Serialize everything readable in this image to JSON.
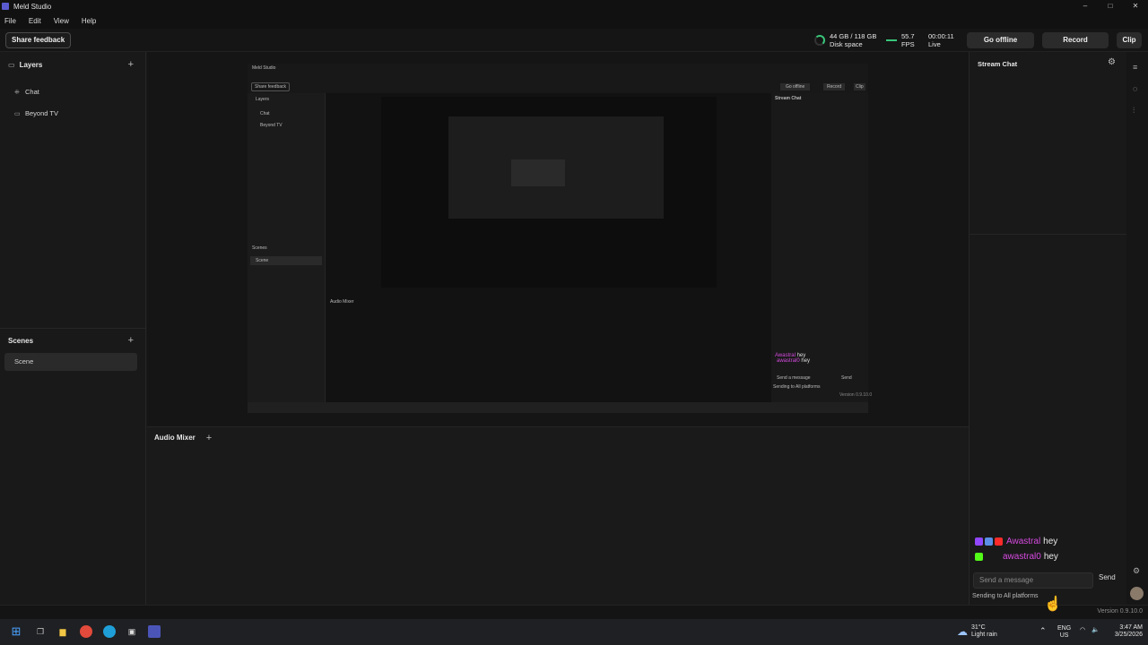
{
  "window": {
    "title": "Meld Studio",
    "controls": [
      "–",
      "□",
      "✕"
    ]
  },
  "menu": [
    "File",
    "Edit",
    "View",
    "Help"
  ],
  "toolbar": {
    "share_feedback": "Share feedback",
    "disk_value": "44 GB / 118 GB",
    "disk_label": "Disk space",
    "fps_value": "55.7",
    "fps_label": "FPS",
    "timer_value": "00:00:11",
    "timer_label": "Live",
    "go_offline": "Go offline",
    "record": "Record",
    "clip": "Clip"
  },
  "layers": {
    "title": "Layers",
    "items": [
      {
        "label": "Chat",
        "icon": "chat-layer-icon"
      },
      {
        "label": "Beyond TV",
        "icon": "monitor-icon"
      }
    ]
  },
  "scenes": {
    "title": "Scenes",
    "items": [
      "Scene"
    ]
  },
  "audio_mixer": {
    "title": "Audio Mixer"
  },
  "preview": {
    "title": "Meld Studio",
    "share_feedback": "Share feedback",
    "layers": "Layers",
    "chat": "Chat",
    "beyond_tv": "Beyond TV",
    "scenes": "Scenes",
    "scene": "Scene",
    "audio_mixer": "Audio Mixer",
    "stream_chat": "Stream Chat",
    "go_offline": "Go offline",
    "record": "Record",
    "clip": "Clip",
    "msg1_user": "Awastral",
    "msg1_text": "hey",
    "msg2_user": "awastral0",
    "msg2_text": "hey",
    "send_placeholder": "Send a message",
    "send": "Send",
    "sending": "Sending to All platforms",
    "version": "Version 0.9.10.0"
  },
  "stream_chat": {
    "title": "Stream Chat",
    "messages": [
      {
        "user": "Awastral",
        "text": "hey",
        "badges": [
          "twitch",
          "chat",
          "youtube"
        ]
      },
      {
        "user": "awastral0",
        "text": "hey",
        "badges": [
          "kick"
        ]
      }
    ],
    "input_placeholder": "Send a message",
    "send": "Send",
    "sending_to": "Sending to All platforms"
  },
  "footer": {
    "version": "Version 0.9.10.0"
  },
  "taskbar": {
    "weather_temp": "31°C",
    "weather_desc": "Light rain",
    "lang1": "ENG",
    "lang2": "US",
    "time": "3:47 AM",
    "date": "3/25/2026"
  },
  "colors": {
    "accent_green": "#38c77a",
    "username_pink": "#d64ae0",
    "twitch": "#9146ff",
    "youtube": "#ff2a2a",
    "kick": "#53fc18"
  }
}
